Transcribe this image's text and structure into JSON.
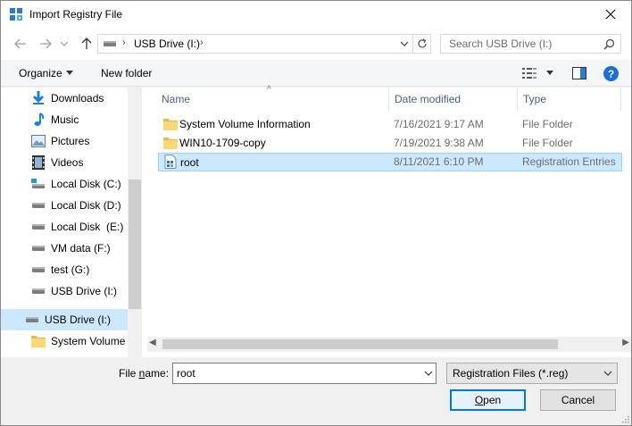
{
  "window": {
    "title": "Import Registry File"
  },
  "address": {
    "path": "USB Drive (I:)",
    "search_placeholder": "Search USB Drive (I:)"
  },
  "toolbar": {
    "organize": "Organize",
    "new_folder": "New folder",
    "help": "?"
  },
  "nav": {
    "items": [
      {
        "label": "Downloads",
        "icon": "downloads-icon"
      },
      {
        "label": "Music",
        "icon": "music-icon"
      },
      {
        "label": "Pictures",
        "icon": "pictures-icon"
      },
      {
        "label": "Videos",
        "icon": "videos-icon"
      },
      {
        "label": "Local Disk (C:)",
        "icon": "system-drive-icon"
      },
      {
        "label": "Local Disk (D:)",
        "icon": "drive-icon"
      },
      {
        "label": "Local Disk  (E:)",
        "icon": "drive-icon"
      },
      {
        "label": "VM data (F:)",
        "icon": "drive-icon"
      },
      {
        "label": "test (G:)",
        "icon": "drive-icon"
      },
      {
        "label": "USB Drive (I:)",
        "icon": "drive-icon"
      },
      {
        "label": "USB Drive (I:)",
        "icon": "drive-icon",
        "selected": true
      },
      {
        "label": "System Volume I",
        "icon": "folder-icon"
      }
    ]
  },
  "columns": {
    "name": "Name",
    "date": "Date modified",
    "type": "Type"
  },
  "files": [
    {
      "name": "System Volume Information",
      "date": "7/16/2021 9:17 AM",
      "type": "File Folder",
      "icon": "folder-icon"
    },
    {
      "name": "WIN10-1709-copy",
      "date": "7/19/2021 9:38 AM",
      "type": "File Folder",
      "icon": "folder-icon"
    },
    {
      "name": "root",
      "date": "8/11/2021 6:10 PM",
      "type": "Registration Entries",
      "icon": "registry-file-icon",
      "selected": true
    }
  ],
  "bottom": {
    "file_name_label_pre": "File ",
    "file_name_label_u": "n",
    "file_name_label_post": "ame:",
    "file_name_value": "root",
    "file_type": "Registration Files (*.reg)",
    "open_pre": "",
    "open_u": "O",
    "open_post": "pen",
    "cancel": "Cancel"
  },
  "colors": {
    "selection": "#cce8ff",
    "accent": "#0078d7"
  }
}
